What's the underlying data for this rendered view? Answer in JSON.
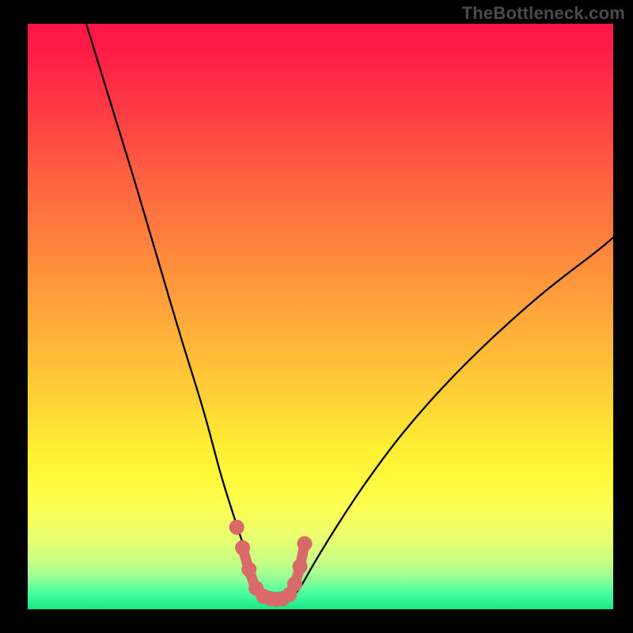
{
  "watermark": "TheBottleneck.com",
  "chart_data": {
    "type": "line",
    "title": "",
    "xlabel": "",
    "ylabel": "",
    "xlim": [
      0,
      100
    ],
    "ylim": [
      0,
      100
    ],
    "grid": false,
    "legend": false,
    "series": [
      {
        "name": "curve-left",
        "stroke": "#000000",
        "x": [
          10,
          14,
          18,
          22,
          26,
          30,
          33,
          35.5,
          37.5,
          38.5,
          39.7,
          40.5
        ],
        "y": [
          100,
          87,
          74,
          60.5,
          47,
          34,
          23,
          15,
          9,
          6,
          3.5,
          2
        ]
      },
      {
        "name": "curve-right",
        "stroke": "#000000",
        "x": [
          45,
          46,
          47.3,
          49,
          53,
          58,
          64,
          71,
          79,
          88,
          97,
          100
        ],
        "y": [
          2,
          3,
          5,
          8,
          14.5,
          22,
          30,
          38,
          46,
          54,
          61,
          63.5
        ]
      },
      {
        "name": "valley-floor-markers",
        "stroke": "#d86a6a",
        "marker": "circle",
        "x": [
          36.7,
          37.8,
          39.0,
          40.3,
          41.5,
          42.5,
          43.5,
          44.7,
          45.6,
          46.5,
          47.3
        ],
        "y": [
          10.5,
          6.8,
          3.6,
          2.2,
          1.8,
          1.7,
          1.8,
          2.5,
          4.3,
          7.3,
          11.2
        ]
      },
      {
        "name": "extra-marker-left",
        "stroke": "#d86a6a",
        "marker": "circle",
        "x": [
          35.7
        ],
        "y": [
          14.0
        ]
      }
    ]
  }
}
